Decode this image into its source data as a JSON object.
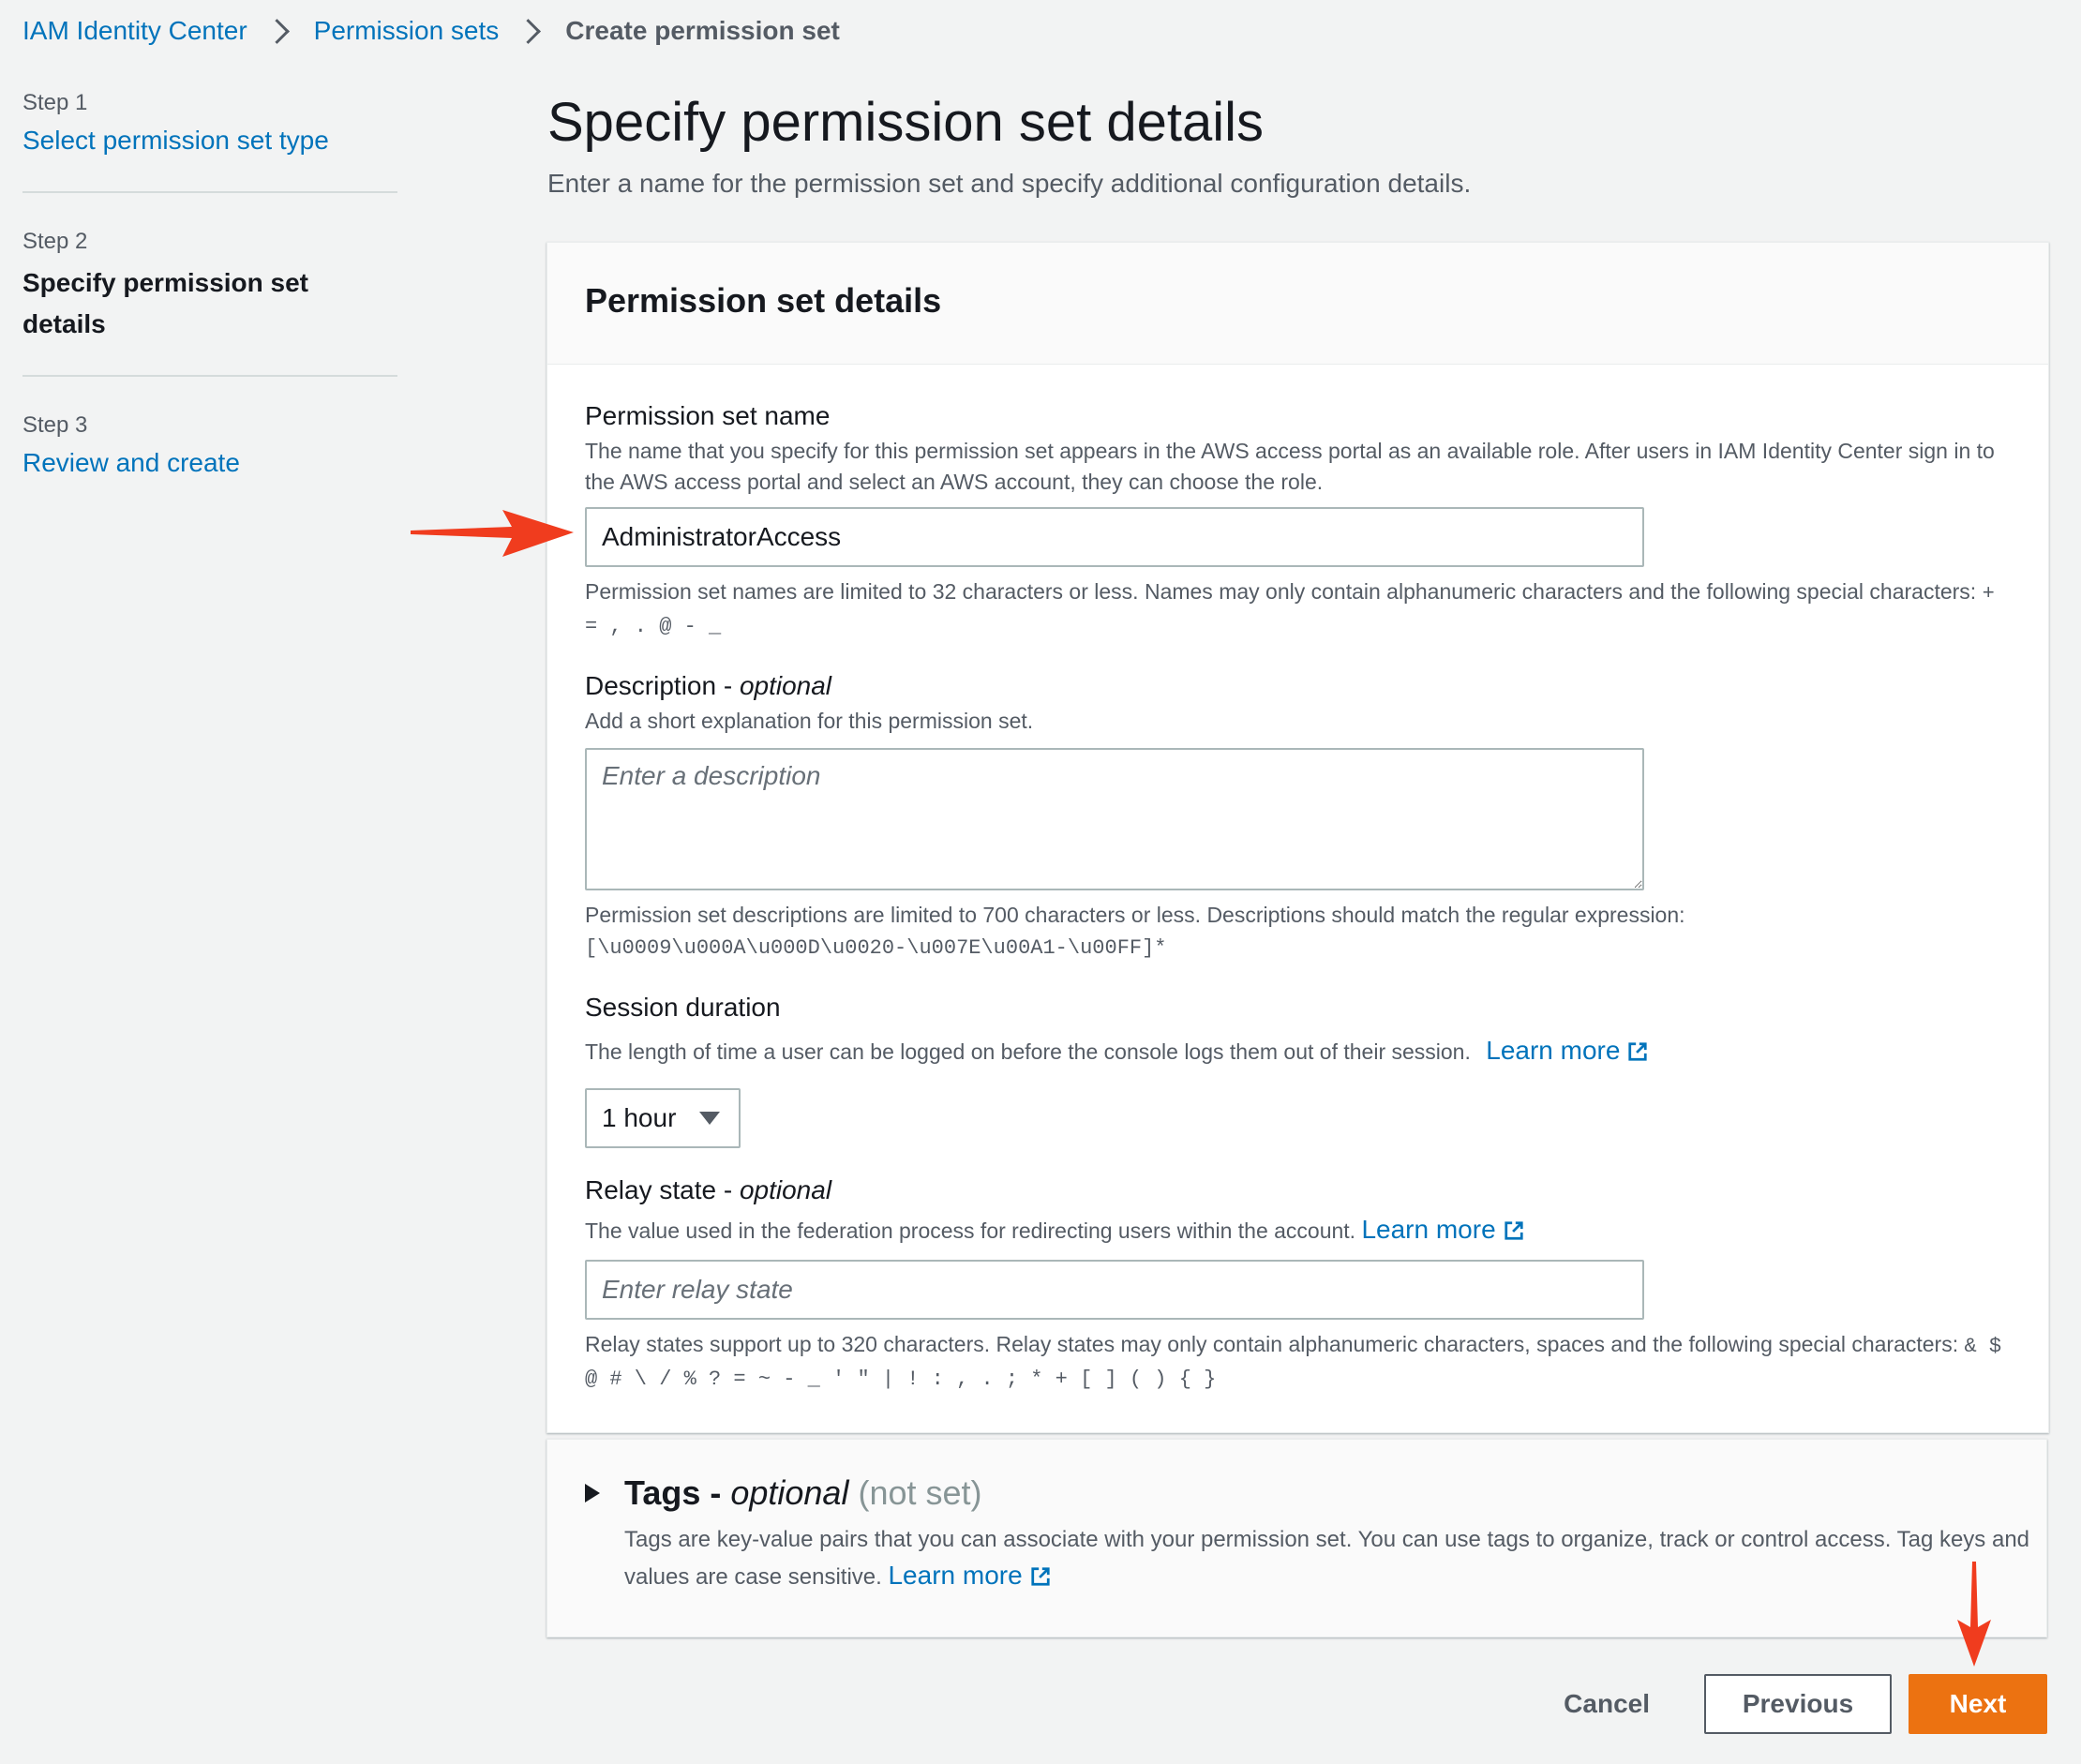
{
  "breadcrumb": {
    "items": [
      "IAM Identity Center",
      "Permission sets",
      "Create permission set"
    ]
  },
  "steps": [
    {
      "label": "Step 1",
      "title": "Select permission set type"
    },
    {
      "label": "Step 2",
      "title": "Specify permission set details"
    },
    {
      "label": "Step 3",
      "title": "Review and create"
    }
  ],
  "page": {
    "title": "Specify permission set details",
    "subtitle": "Enter a name for the permission set and specify additional configuration details."
  },
  "details_panel": {
    "header": "Permission set details",
    "name": {
      "label": "Permission set name",
      "description": "The name that you specify for this permission set appears in the AWS access portal as an available role. After users in IAM Identity Center sign in to the AWS access portal and select an AWS account, they can choose the role.",
      "value": "AdministratorAccess",
      "constraint": "Permission set names are limited to 32 characters or less. Names may only contain alphanumeric characters and the following special characters:",
      "constraint_chars": "+ = , . @ - _"
    },
    "description_field": {
      "label": "Description - ",
      "label_optional": "optional",
      "description": "Add a short explanation for this permission set.",
      "placeholder": "Enter a description",
      "constraint": "Permission set descriptions are limited to 700 characters or less. Descriptions should match the regular expression:",
      "constraint_regex": "[\\u0009\\u000A\\u000D\\u0020-\\u007E\\u00A1-\\u00FF]*"
    },
    "session": {
      "label": "Session duration",
      "description": "The length of time a user can be logged on before the console logs them out of their session.",
      "learn_more": "Learn more",
      "selected": "1 hour"
    },
    "relay": {
      "label": "Relay state - ",
      "label_optional": "optional",
      "description": "The value used in the federation process for redirecting users within the account.",
      "learn_more": "Learn more",
      "placeholder": "Enter relay state",
      "constraint": "Relay states support up to 320 characters. Relay states may only contain alphanumeric characters, spaces and the following special characters:",
      "constraint_chars": "& $ @ # \\ / % ? = ~ - _ ' \" | ! : , . ; * + [ ] ( ) { }"
    }
  },
  "tags_panel": {
    "title": "Tags - ",
    "title_optional": "optional",
    "status": "(not set)",
    "description": "Tags are key-value pairs that you can associate with your permission set. You can use tags to organize, track or control access. Tag keys and values are case sensitive.",
    "learn_more": "Learn more"
  },
  "footer": {
    "cancel": "Cancel",
    "previous": "Previous",
    "next": "Next"
  },
  "colors": {
    "link": "#0073bb",
    "primary": "#ec7211",
    "annotation_arrow": "#f03c1e"
  },
  "icons": {
    "external_link": "external-link-icon",
    "dropdown": "caret-down-icon",
    "expand": "caret-right-icon",
    "annotation": "red-arrow-icon"
  }
}
